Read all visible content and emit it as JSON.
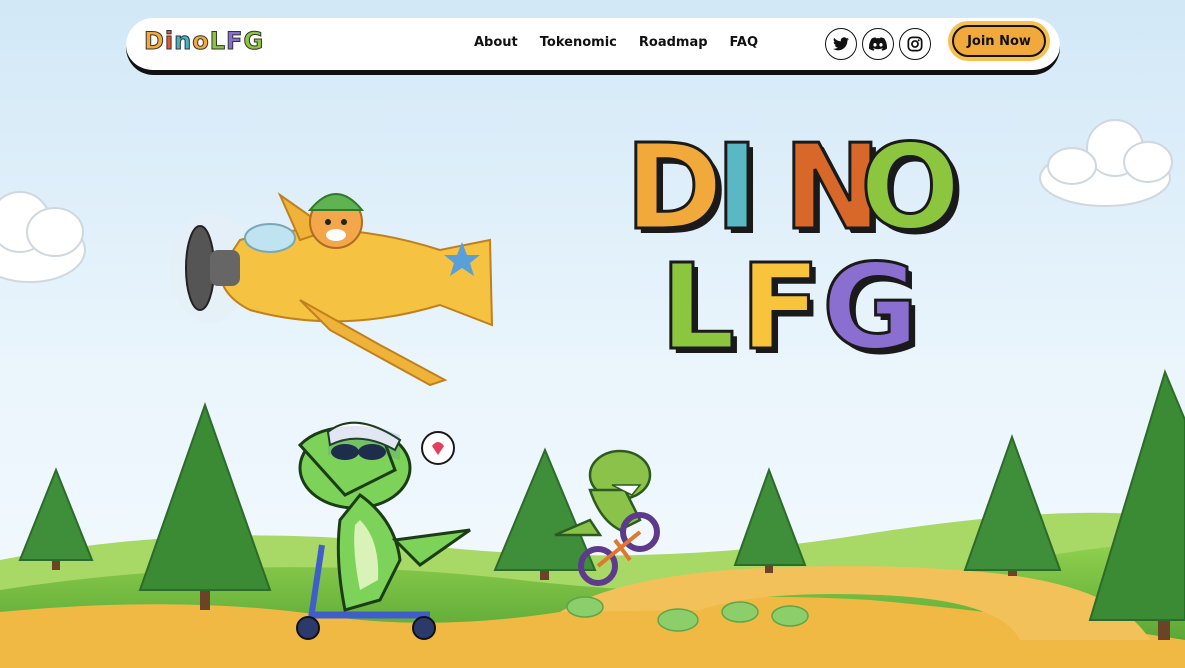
{
  "brand": {
    "logo_letters": [
      {
        "char": "D",
        "color": "#f2a93b"
      },
      {
        "char": "i",
        "color": "#e8542e"
      },
      {
        "char": "n",
        "color": "#3fb6c6"
      },
      {
        "char": "o",
        "color": "#f2a93b"
      },
      {
        "char": "L",
        "color": "#8cc63f"
      },
      {
        "char": "F",
        "color": "#8a6fd1"
      },
      {
        "char": "G",
        "color": "#8cc63f"
      }
    ]
  },
  "nav": {
    "items": [
      {
        "label": "About"
      },
      {
        "label": "Tokenomic"
      },
      {
        "label": "Roadmap"
      },
      {
        "label": "FAQ"
      }
    ]
  },
  "social": [
    {
      "icon": "twitter-icon"
    },
    {
      "icon": "discord-icon"
    },
    {
      "icon": "instagram-icon"
    }
  ],
  "cta": {
    "join_label": "Join Now"
  },
  "hero": {
    "line1": [
      {
        "char": "D",
        "color": "#f2a93b"
      },
      {
        "char": "I",
        "color": "#5ab8c4"
      },
      {
        "char": "N",
        "color": "#d8672a"
      },
      {
        "char": "O",
        "color": "#8cc63f"
      }
    ],
    "line2": [
      {
        "char": "L",
        "color": "#8cc63f"
      },
      {
        "char": "F",
        "color": "#f7c43c"
      },
      {
        "char": "G",
        "color": "#8a6fd1"
      }
    ]
  },
  "colors": {
    "sky_top": "#d9ecf9",
    "sky_bottom": "#eef7fd",
    "grass": "#7cc242",
    "grass_dark": "#4a9a2e",
    "path": "#f0b944",
    "tree": "#3f8f3a"
  }
}
